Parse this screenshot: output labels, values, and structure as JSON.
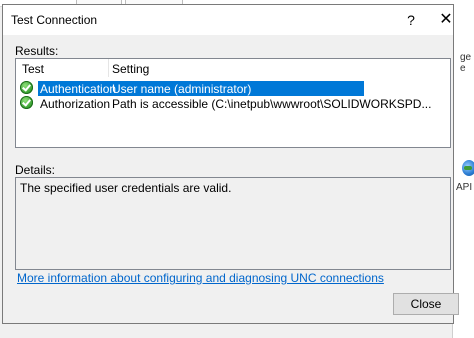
{
  "dialog": {
    "title": "Test Connection",
    "help_label": "?",
    "close_glyph": "✕"
  },
  "results": {
    "label": "Results:",
    "columns": [
      "Test",
      "Setting"
    ],
    "rows": [
      {
        "test": "Authentication",
        "setting": "User name (administrator)",
        "status": "passed",
        "selected": true
      },
      {
        "test": "Authorization",
        "setting": "Path is accessible (C:\\inetpub\\wwwroot\\SOLIDWORKSPD...",
        "status": "passed",
        "selected": false
      }
    ]
  },
  "details": {
    "label": "Details:",
    "text": "The specified user credentials are valid."
  },
  "link": {
    "text": "More information about configuring and diagnosing UNC connections"
  },
  "buttons": {
    "close_label": "Close"
  },
  "background": {
    "frag1": "ge\ne",
    "frag2": "API"
  },
  "colors": {
    "selection": "#0078d7",
    "link": "#0066cc",
    "success_icon": "#2f9a2a"
  },
  "icons": {
    "status_passed": "check-circle-icon"
  }
}
